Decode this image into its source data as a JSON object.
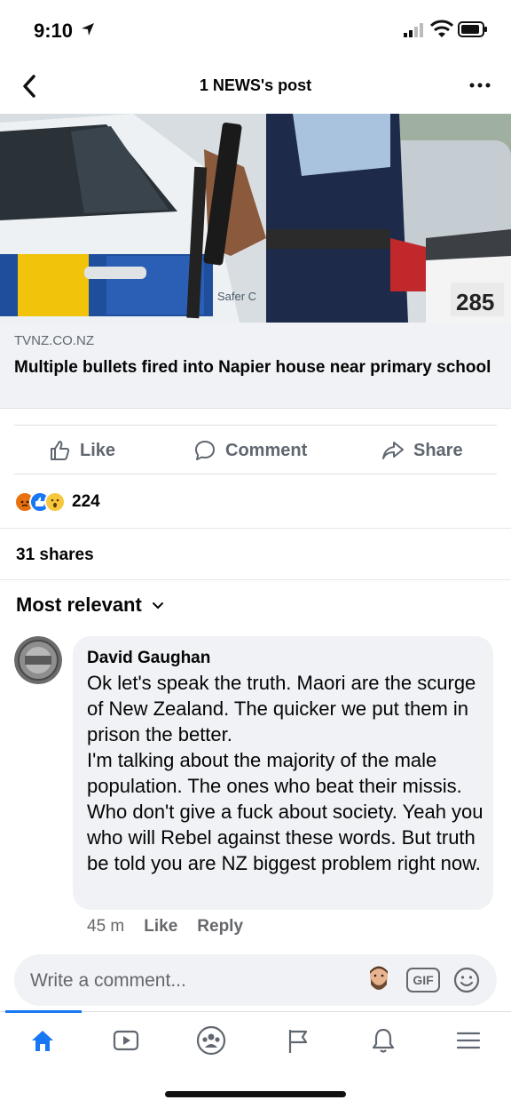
{
  "status_bar": {
    "time": "9:10"
  },
  "header": {
    "title": "1 NEWS's post"
  },
  "link_card": {
    "domain": "TVNZ.CO.NZ",
    "title": "Multiple bullets fired into Napier house near primary school",
    "image_text": {
      "car_text": "Safer C",
      "mailbox_number": "285"
    }
  },
  "actions": {
    "like": "Like",
    "comment": "Comment",
    "share": "Share"
  },
  "reactions": {
    "icons": [
      "angry",
      "like",
      "wow"
    ],
    "count": "224"
  },
  "shares": "31 shares",
  "sort": {
    "label": "Most relevant"
  },
  "comment": {
    "author": "David Gaughan",
    "text": "Ok let's speak the truth. Maori are the scurge of New Zealand. The quicker we put them in prison the better.\nI'm talking about the majority of the male population. The ones who beat their missis. Who don't give a fuck about society. Yeah you who will Rebel against these words. But truth be told you are NZ biggest problem right now.",
    "time": "45 m",
    "like": "Like",
    "reply": "Reply"
  },
  "composer": {
    "placeholder": "Write a comment...",
    "gif": "GIF"
  },
  "tabs": [
    "home-icon",
    "video-icon",
    "groups-icon",
    "pages-flag-icon",
    "notifications-bell-icon",
    "menu-icon"
  ],
  "colors": {
    "accent": "#1877f2",
    "muted": "#65676b",
    "bubble": "#f0f2f5"
  }
}
